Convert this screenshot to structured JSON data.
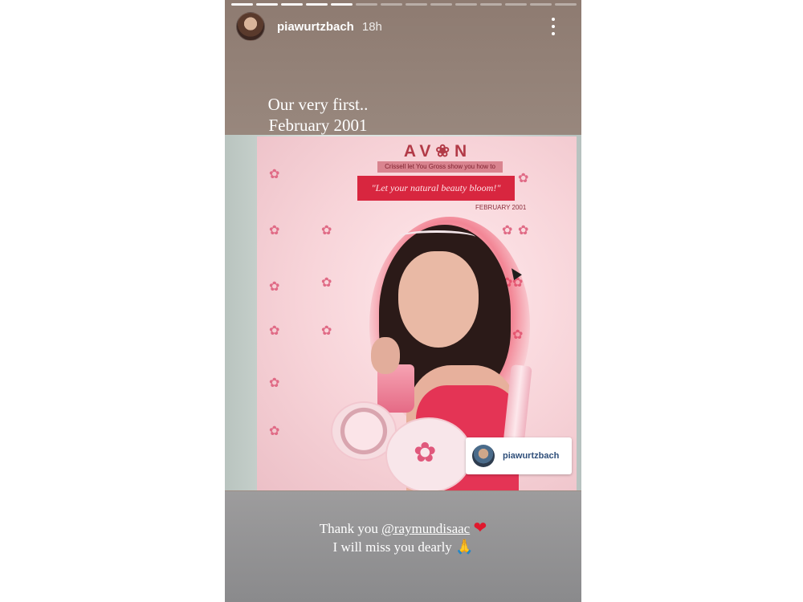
{
  "story": {
    "username": "piawurtzbach",
    "timestamp": "18h",
    "progress": {
      "segments": 14,
      "completed": 5
    },
    "caption_top": {
      "line1": "Our very first..",
      "line2": "February 2001"
    },
    "poster": {
      "brand": "AV❀N",
      "subline": "Crissell let You Gross show you how to",
      "tagline": "\"Let your natural beauty bloom!\"",
      "date": "FEBRUARY 2001"
    },
    "mention_sticker": {
      "username": "piawurtzbach"
    },
    "caption_bottom": {
      "thank_you": "Thank you",
      "mention": "@raymundisaac",
      "heart_glyph": "❤",
      "line2": "I will miss you dearly",
      "pray_glyph": "🙏"
    },
    "icons": [
      "avatar",
      "more-vertical-icon",
      "heart-icon",
      "pray-icon",
      "cursor-icon"
    ]
  }
}
